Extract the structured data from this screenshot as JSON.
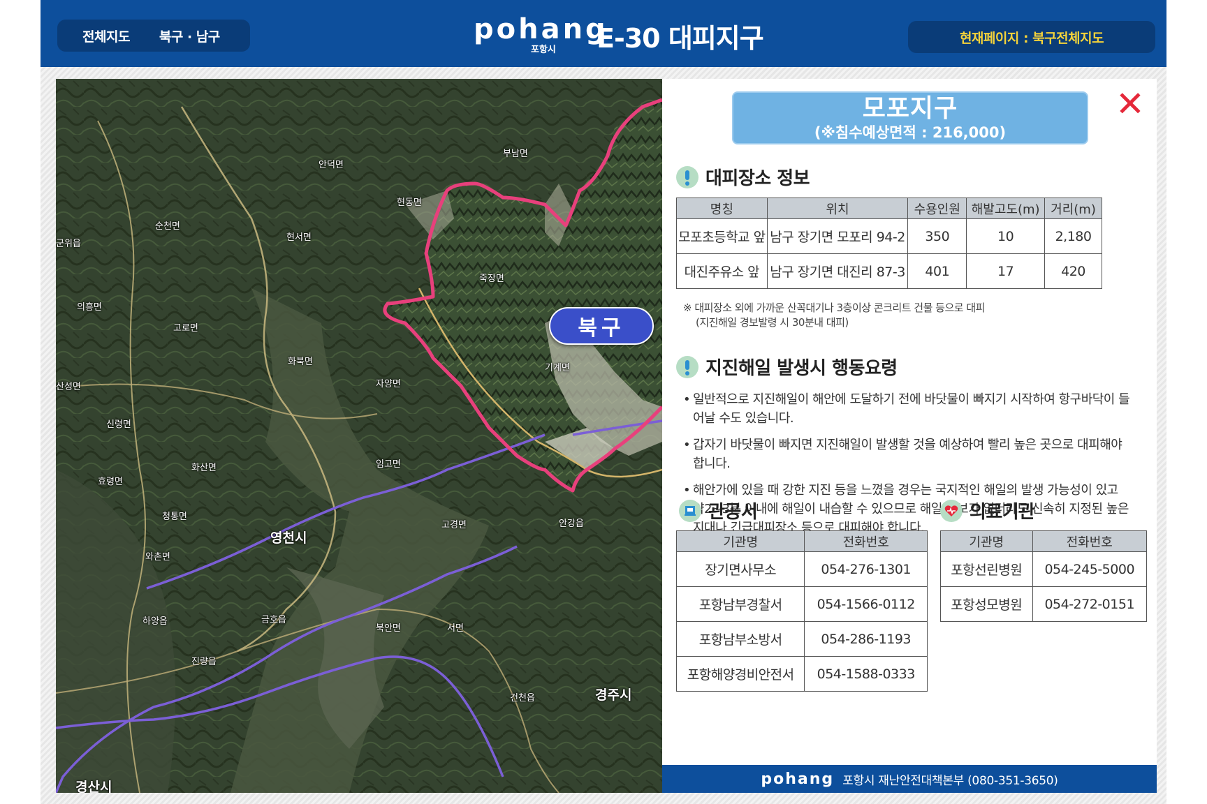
{
  "header": {
    "nav": [
      "전체지도",
      "북구 · 남구"
    ],
    "logo_text": "pohang",
    "logo_sub": "포항시",
    "title": "E-30 대피지구",
    "current_page": "현재페이지 : 북구전체지도"
  },
  "map": {
    "district_button": "북구",
    "labels": [
      "영천시",
      "경주시",
      "경산시",
      "기계면",
      "죽장면",
      "신령면",
      "화북면",
      "자양면",
      "임고면",
      "고경면",
      "금호읍",
      "북안면",
      "하양읍",
      "진량읍",
      "와촌면",
      "청통면",
      "화산면",
      "고로면",
      "의흥면",
      "산성면",
      "효령면",
      "군위읍",
      "안강읍",
      "서면",
      "건천읍",
      "현동면",
      "현서면",
      "안덕면",
      "부남면",
      "순천면"
    ]
  },
  "panel": {
    "district_name": "모포지구",
    "district_area": "(※침수예상면적 : 216,000)",
    "close_icon": "close-x-icon",
    "shelter_title": "대피장소 정보",
    "shelter_headers": [
      "명칭",
      "위치",
      "수용인원",
      "해발고도(m)",
      "거리(m)"
    ],
    "shelters": [
      [
        "모포초등학교 앞",
        "남구 장기면 모포리 94-2",
        "350",
        "10",
        "2,180"
      ],
      [
        "대진주유소 앞",
        "남구 장기면 대진리 87-3",
        "401",
        "17",
        "420"
      ]
    ],
    "note_line1": "※ 대피장소 외에 가까운 산꼭대기나 3층이상 콘크리트 건물 등으로 대피",
    "note_line2": "(지진해일 경보발령 시 30분내 대피)",
    "action_title": "지진해일 발생시 행동요령",
    "actions": [
      "일반적으로 지진해일이 해안에 도달하기 전에 바닷물이 빠지기 시작하여 항구바닥이 들어날 수도 있습니다.",
      "갑자기 바닷물이 빠지면 지진해일이 발생할 것을 예상하여 빨리 높은 곳으로 대피해야 합니다.",
      "해안가에 있을 때 강한 지진 등을 느꼈을 경우는 국지적인 해일의 발생 가능성이 있고 약2~3분 이내에  해일이 내습할 수 있으므로 해일 경보가 없더라도 신속히 지정된 높은 지대나 긴급대피장소 등으로 대피해야 합니다."
    ],
    "office_title": "관공서",
    "office_headers": [
      "기관명",
      "전화번호"
    ],
    "offices": [
      [
        "장기면사무소",
        "054-276-1301"
      ],
      [
        "포항남부경찰서",
        "054-1566-0112"
      ],
      [
        "포항남부소방서",
        "054-286-1193"
      ],
      [
        "포항해양경비안전서",
        "054-1588-0333"
      ]
    ],
    "medical_title": "의료기관",
    "medical_headers": [
      "기관명",
      "전화번호"
    ],
    "medicals": [
      [
        "포항선린병원",
        "054-245-5000"
      ],
      [
        "포항성모병원",
        "054-272-0151"
      ]
    ]
  },
  "footer": {
    "logo_text": "pohang",
    "text": "포항시 재난안전대책본부 (080-351-3650)"
  },
  "colors": {
    "header_bg": "#0d4f9c",
    "pill_bg": "#0a3c78",
    "current_page_text": "#f5d33a",
    "district_box": "#6fb2e3",
    "close": "#e5283a",
    "boundary": "#e8407c",
    "route": "#7b5fd6"
  }
}
